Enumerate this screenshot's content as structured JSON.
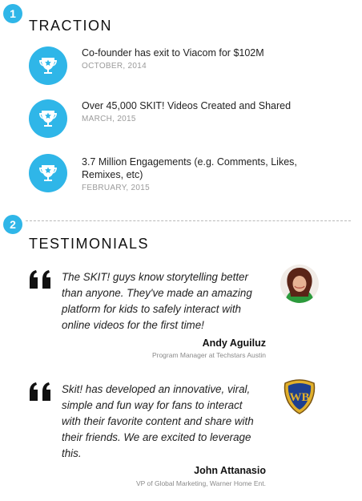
{
  "traction": {
    "step_number": "1",
    "title": "TRACTION",
    "items": [
      {
        "headline": "Co-founder has exit to Viacom for $102M",
        "date": "OCTOBER, 2014",
        "icon": "trophy-icon"
      },
      {
        "headline": "Over 45,000 SKIT! Videos Created and Shared",
        "date": "MARCH, 2015",
        "icon": "trophy-icon"
      },
      {
        "headline": "3.7 Million Engagements (e.g. Comments, Likes, Remixes, etc)",
        "date": "FEBRUARY, 2015",
        "icon": "trophy-icon"
      }
    ]
  },
  "testimonials": {
    "step_number": "2",
    "title": "TESTIMONIALS",
    "items": [
      {
        "quote": "The SKIT! guys know storytelling better than anyone. They've made an amazing platform for kids to safely interact with online videos for the first time!",
        "author": "Andy Aguiluz",
        "role": "Program Manager at Techstars Austin",
        "image": "person-photo"
      },
      {
        "quote": "Skit! has developed an innovative, viral, simple and fun way for fans to interact with their favorite content and share with their friends. We are excited to leverage this.",
        "author": "John Attanasio",
        "role": "VP of Global Marketing, Warner Home Ent.",
        "image": "warner-bros-shield-logo"
      }
    ]
  },
  "colors": {
    "accent": "#2fb6e8",
    "muted_text": "#9a9a9a",
    "dark_text": "#222222"
  }
}
